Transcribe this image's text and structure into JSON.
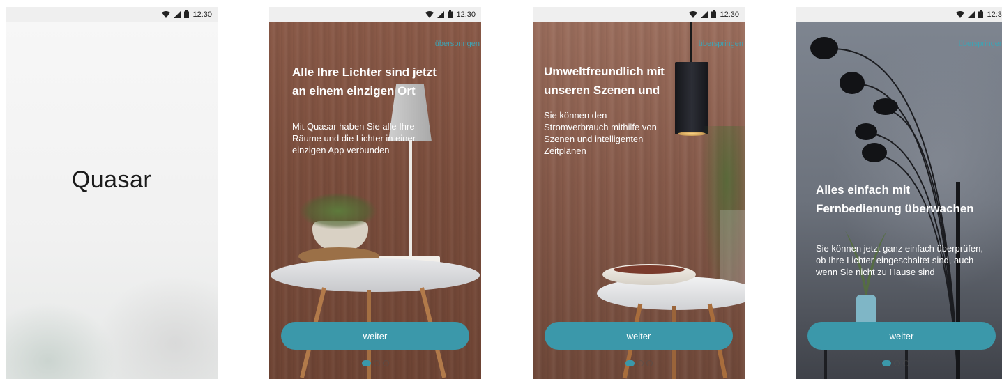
{
  "status_bar": {
    "time": "12:30"
  },
  "splash": {
    "logo_text": "Quasar"
  },
  "slides": [
    {
      "skip_label": "überspringen",
      "title": "Alle Ihre Lichter sind jetzt an einem einzigen Ort",
      "body": "Mit Quasar haben Sie alle Ihre Räume und die Lichter in einer einzigen App verbunden",
      "button_label": "weiter",
      "page_index": 1,
      "page_count": 3
    },
    {
      "skip_label": "überspringen",
      "title": "Umweltfreundlich mit unseren Szenen und",
      "body": "Sie können den Stromverbrauch mithilfe von Szenen und intelligenten Zeitplänen",
      "button_label": "weiter",
      "page_index": 1,
      "page_count": 3
    },
    {
      "skip_label": "überspringen",
      "title": "Alles einfach mit Fernbedienung überwachen",
      "body": "Sie können jetzt ganz einfach überprüfen, ob Ihre Lichter eingeschaltet sind, auch wenn Sie nicht zu Hause sind",
      "button_label": "weiter",
      "page_index": 1,
      "page_count": 3
    }
  ],
  "colors": {
    "accent": "#3b98aa",
    "skip": "#3fa3b3"
  },
  "icons": [
    "wifi-icon",
    "signal-icon",
    "battery-icon"
  ]
}
